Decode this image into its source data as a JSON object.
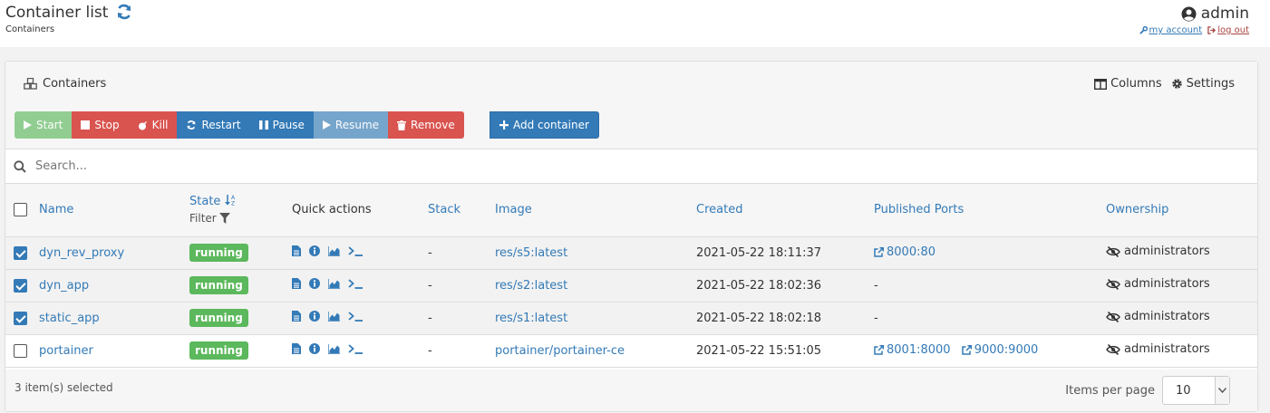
{
  "header": {
    "title": "Container list",
    "breadcrumb": "Containers",
    "user": "admin",
    "my_account": "my account",
    "log_out": "log out"
  },
  "panel": {
    "title": "Containers",
    "columns_label": "Columns",
    "settings_label": "Settings"
  },
  "toolbar": {
    "start": "Start",
    "stop": "Stop",
    "kill": "Kill",
    "restart": "Restart",
    "pause": "Pause",
    "resume": "Resume",
    "remove": "Remove",
    "add_container": "Add container"
  },
  "search": {
    "placeholder": "Search..."
  },
  "table": {
    "headers": {
      "name": "Name",
      "state": "State",
      "filter": "Filter",
      "quick_actions": "Quick actions",
      "stack": "Stack",
      "image": "Image",
      "created": "Created",
      "ports": "Published Ports",
      "ownership": "Ownership"
    },
    "rows": [
      {
        "name": "dyn_rev_proxy",
        "state": "running",
        "stack": "-",
        "image": "res/s5:latest",
        "created": "2021-05-22 18:11:37",
        "port1": "8000:80",
        "port2": "",
        "no_ports": "",
        "ownership": "administrators"
      },
      {
        "name": "dyn_app",
        "state": "running",
        "stack": "-",
        "image": "res/s2:latest",
        "created": "2021-05-22 18:02:36",
        "port1": "",
        "port2": "",
        "no_ports": "-",
        "ownership": "administrators"
      },
      {
        "name": "static_app",
        "state": "running",
        "stack": "-",
        "image": "res/s1:latest",
        "created": "2021-05-22 18:02:18",
        "port1": "",
        "port2": "",
        "no_ports": "-",
        "ownership": "administrators"
      },
      {
        "name": "portainer",
        "state": "running",
        "stack": "-",
        "image": "portainer/portainer-ce",
        "created": "2021-05-22 15:51:05",
        "port1": "8001:8000",
        "port2": "9000:9000",
        "no_ports": "",
        "ownership": "administrators"
      }
    ]
  },
  "footer": {
    "selected": "3 item(s) selected",
    "items_per_page_label": "Items per page",
    "items_per_page": "10"
  },
  "colors": {
    "primary": "#337ab7",
    "success": "#5cb85c",
    "danger": "#d9534f"
  }
}
